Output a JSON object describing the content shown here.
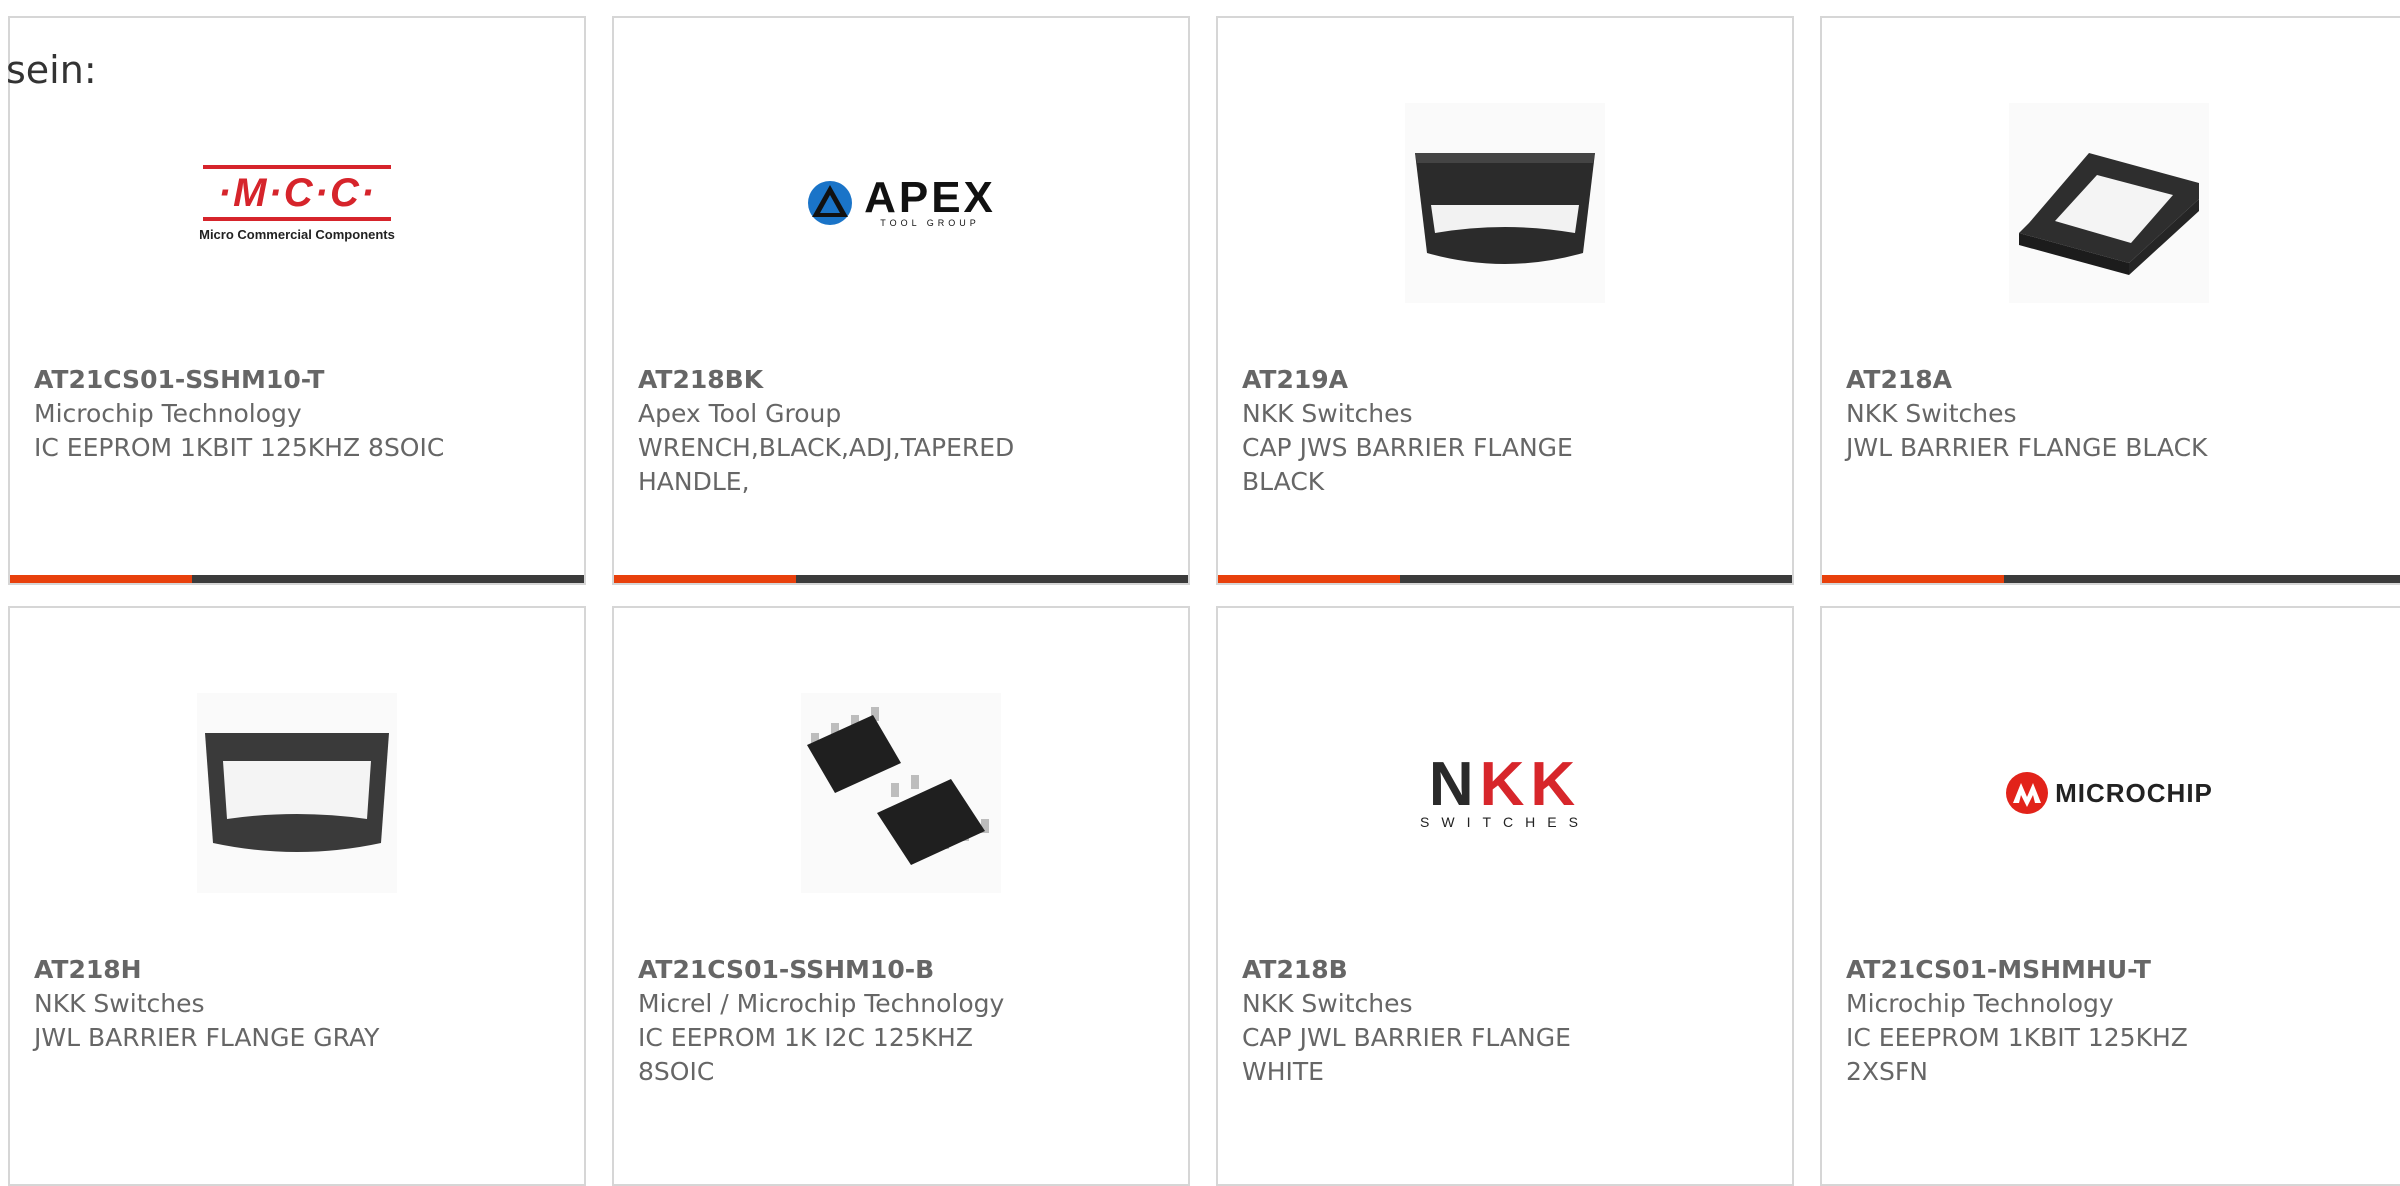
{
  "intro_text": "sein:",
  "colors": {
    "accent": "#e8400c",
    "bar": "#3b3b3b",
    "border": "#d6d6d6",
    "text": "#666666"
  },
  "products": [
    {
      "part": "AT21CS01-SSHM10-T",
      "maker": "Microchip Technology",
      "desc": "IC EEPROM 1KBIT 125KHZ 8SOIC",
      "image": "mcc-logo",
      "logo": {
        "main": "·M·C·C·",
        "sub": "Micro Commercial Components",
        "mark": "™"
      }
    },
    {
      "part": "AT218BK",
      "maker": "Apex Tool Group",
      "desc": "WRENCH,BLACK,ADJ,TAPERED HANDLE,",
      "image": "apex-logo",
      "logo": {
        "main": "APEX",
        "sub": "TOOL GROUP"
      }
    },
    {
      "part": "AT219A",
      "maker": "NKK Switches",
      "desc": "CAP JWS BARRIER FLANGE BLACK",
      "image": "barrier-flange-front-photo"
    },
    {
      "part": "AT218A",
      "maker": "NKK Switches",
      "desc": "JWL BARRIER FLANGE BLACK",
      "image": "barrier-flange-angled-photo"
    },
    {
      "part": "AT218H",
      "maker": "NKK Switches",
      "desc": "JWL BARRIER FLANGE GRAY",
      "image": "barrier-flange-gray-photo"
    },
    {
      "part": "AT21CS01-SSHM10-B",
      "maker": "Micrel / Microchip Technology",
      "desc": "IC EEPROM 1K I2C 125KHZ 8SOIC",
      "image": "soic-chip-photo"
    },
    {
      "part": "AT218B",
      "maker": "NKK Switches",
      "desc": "CAP JWL BARRIER FLANGE WHITE",
      "image": "nkk-logo",
      "logo": {
        "main": "NKK",
        "sub": "SWITCHES"
      }
    },
    {
      "part": "AT21CS01-MSHMHU-T",
      "maker": "Microchip Technology",
      "desc": "IC EEEPROM 1KBIT 125KHZ 2XSFN",
      "image": "microchip-logo",
      "logo": {
        "main": "MICROCHIP"
      }
    }
  ]
}
